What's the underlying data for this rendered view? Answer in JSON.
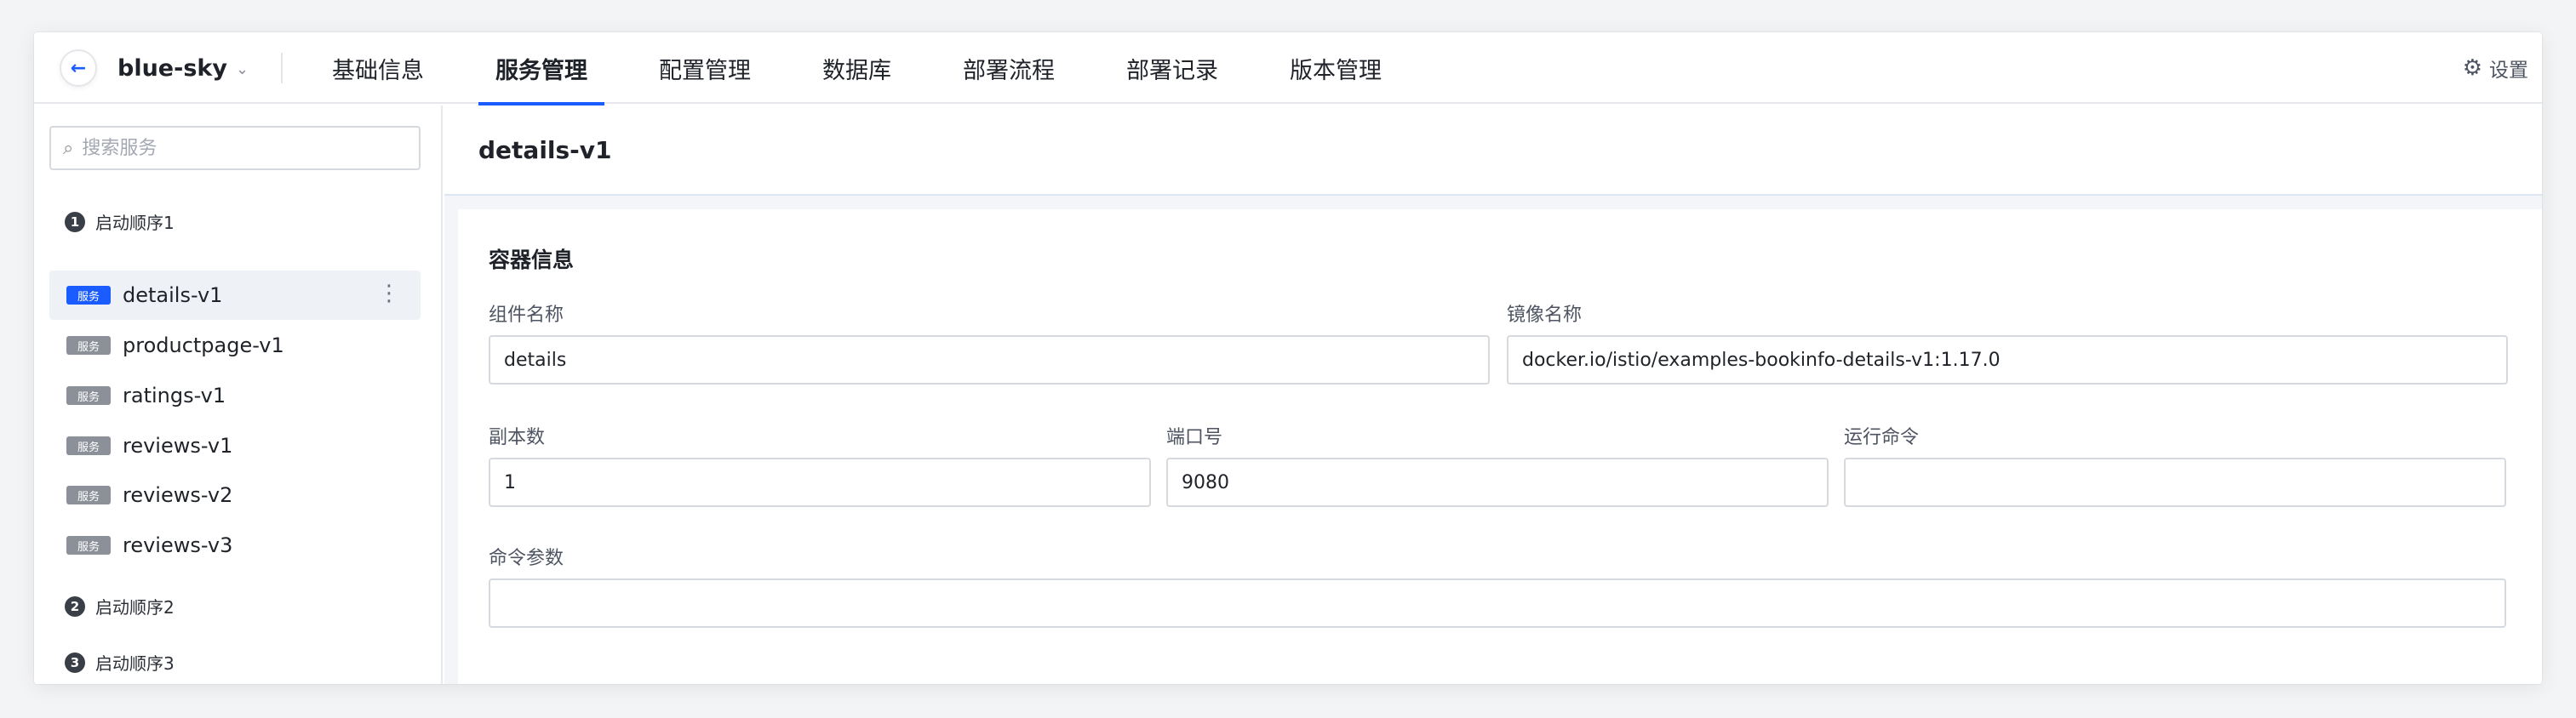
{
  "header": {
    "project_name": "blue-sky",
    "tabs": [
      {
        "label": "基础信息"
      },
      {
        "label": "服务管理",
        "active": true
      },
      {
        "label": "配置管理"
      },
      {
        "label": "数据库"
      },
      {
        "label": "部署流程"
      },
      {
        "label": "部署记录"
      },
      {
        "label": "版本管理"
      }
    ],
    "settings_label": "设置"
  },
  "sidebar": {
    "search_placeholder": "搜索服务",
    "groups": [
      {
        "number": "1",
        "label": "启动顺序1"
      },
      {
        "number": "2",
        "label": "启动顺序2"
      },
      {
        "number": "3",
        "label": "启动顺序3"
      }
    ],
    "badge_label": "服务",
    "services": [
      {
        "name": "details-v1",
        "selected": true
      },
      {
        "name": "productpage-v1"
      },
      {
        "name": "ratings-v1"
      },
      {
        "name": "reviews-v1"
      },
      {
        "name": "reviews-v2"
      },
      {
        "name": "reviews-v3"
      }
    ],
    "more_glyph": "⋮"
  },
  "main": {
    "title": "details-v1",
    "section_title": "容器信息",
    "fields": {
      "component_name": {
        "label": "组件名称",
        "value": "details"
      },
      "image_name": {
        "label": "镜像名称",
        "value": "docker.io/istio/examples-bookinfo-details-v1:1.17.0"
      },
      "replicas": {
        "label": "副本数",
        "value": "1"
      },
      "port": {
        "label": "端口号",
        "value": "9080"
      },
      "run_command": {
        "label": "运行命令",
        "value": ""
      },
      "command_args": {
        "label": "命令参数",
        "value": ""
      }
    }
  },
  "colors": {
    "accent": "#1a5cff",
    "badge_gray": "#8b9099"
  }
}
